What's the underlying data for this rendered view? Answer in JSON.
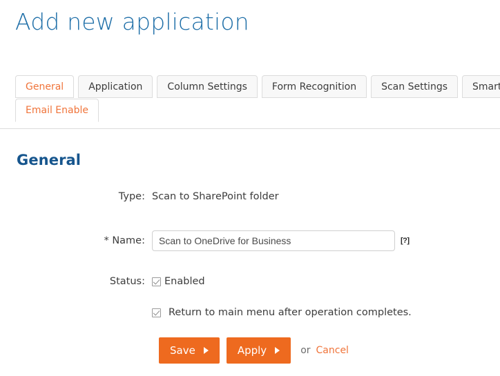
{
  "page": {
    "title": "Add new application",
    "title_color": "#1f6fa8"
  },
  "tabs": {
    "row1": [
      {
        "label": "General",
        "state": "link"
      },
      {
        "label": "Application",
        "state": "inactive"
      },
      {
        "label": "Column Settings",
        "state": "inactive"
      },
      {
        "label": "Form Recognition",
        "state": "inactive"
      },
      {
        "label": "Scan Settings",
        "state": "inactive"
      },
      {
        "label": "Smart Scan",
        "state": "inactive"
      }
    ],
    "row2": [
      {
        "label": "Email Enable",
        "state": "active"
      }
    ]
  },
  "section": {
    "heading": "General",
    "heading_color": "#16558d"
  },
  "form": {
    "type": {
      "label": "Type:",
      "value": "Scan to SharePoint folder"
    },
    "name": {
      "label": "* Name:",
      "value": "Scan to OneDrive for Business",
      "placeholder": "",
      "help": "[?]"
    },
    "status": {
      "label": "Status:",
      "enabled_label": "Enabled",
      "enabled_checked": true
    },
    "return_to_menu": {
      "label": "Return to main menu after operation completes.",
      "checked": true
    }
  },
  "actions": {
    "save_label": "Save",
    "apply_label": "Apply",
    "or_label": "or",
    "cancel_label": "Cancel",
    "button_color": "#ee6a1f",
    "link_color": "#f0743a"
  }
}
